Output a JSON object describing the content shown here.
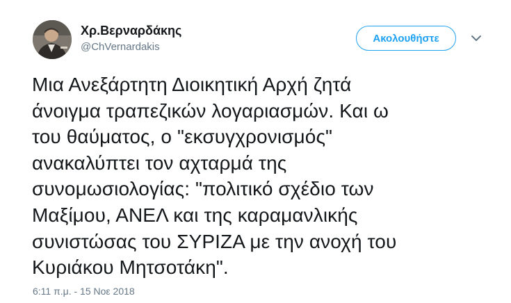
{
  "user": {
    "display_name": "Χρ.Βερναρδάκης",
    "handle": "@ChVernardakis"
  },
  "header": {
    "follow_label": "Ακολουθήστε",
    "menu_icon": "chevron-down-icon",
    "accent_color": "#1da1f2"
  },
  "tweet": {
    "lines": [
      "Μια Ανεξάρτητη Διοικητική Αρχή ζητά",
      "άνοιγμα τραπεζικών λογαριασμών. Και ω",
      "του θαύματος, ο \"εκσυγχρονισμός\"",
      "ανακαλύπτει τον αχταρμά της",
      "συνομωσιολογίας: \"πολιτικό σχέδιο των",
      "Μαξίμου, ΑΝΕΛ και της καραμανλικής",
      "συνιστώσας του ΣΥΡΙΖΑ με την ανοχή του",
      "Κυριάκου Μητσοτάκη\"."
    ],
    "timestamp": "6:11 π.μ. - 15 Νοε 2018"
  }
}
